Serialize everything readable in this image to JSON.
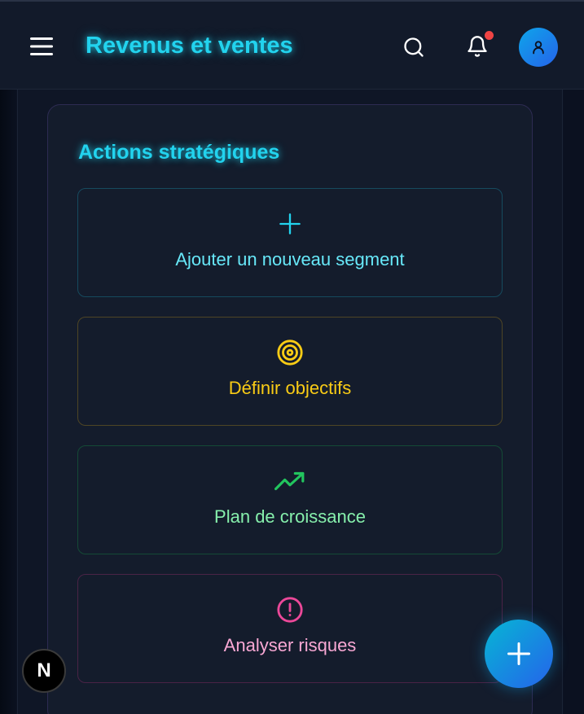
{
  "header": {
    "title": "Revenus et ventes",
    "icons": {
      "menu": "hamburger-menu-icon",
      "search": "search-icon",
      "notifications": "bell-icon",
      "profile": "user-icon"
    },
    "has_notification": true
  },
  "section": {
    "title": "Actions stratégiques",
    "actions": [
      {
        "label": "Ajouter un nouveau segment",
        "icon": "plus-icon",
        "color": "#22d3ee"
      },
      {
        "label": "Définir objectifs",
        "icon": "target-icon",
        "color": "#facc15"
      },
      {
        "label": "Plan de croissance",
        "icon": "trending-up-icon",
        "color": "#22c55e"
      },
      {
        "label": "Analyser risques",
        "icon": "alert-circle-icon",
        "color": "#ec4899"
      }
    ]
  },
  "fab": {
    "icon": "plus-icon"
  },
  "dev_badge": {
    "letter": "N"
  },
  "colors": {
    "accent": "#22d3ee",
    "background": "#0f1626",
    "card": "#141c2c",
    "notification": "#ef4444"
  }
}
